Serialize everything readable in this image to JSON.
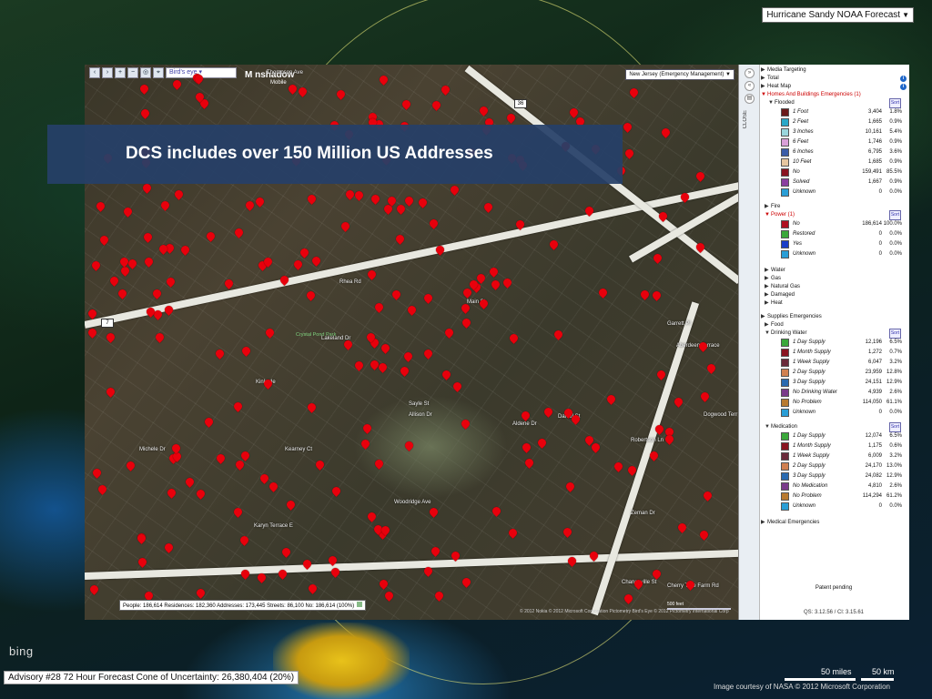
{
  "forecast_dropdown": "Hurricane Sandy NOAA Forecast",
  "bing_logo": "bing",
  "advisory_text": "Advisory #28 72 Hour Forecast Cone of Uncertainty: 26,380,404 (20%)",
  "scale_miles": "50 miles",
  "scale_km": "50 km",
  "image_credit": "Image courtesy of NASA   © 2012 Microsoft Corporation",
  "banner_text": "DCS includes over 150 Million US Addresses",
  "map": {
    "birds_eye": "Bird's eye",
    "logo_main": "M   nshadow",
    "logo_sub": "Mobile",
    "region": "New Jersey (Emergency Management)",
    "park": "Crystal Pond Park",
    "route_7": "7",
    "route_36": "36",
    "status": "People: 186,614  Residences: 182,360  Addresses: 173,445  Streets: 86,100  No: 186,614 (100%)",
    "credit": "© 2012 Nokia   © 2012 Microsoft Corporation   Pictometry Bird's Eye © 2012 Pictometry International Corp",
    "scale": "500 feet",
    "streets": [
      "Thompson Ave",
      "Main St",
      "Garrett Pl",
      "Kinkade",
      "Lakeland Dr",
      "Sayle St",
      "Allison Dr",
      "Woodridge Ave",
      "Karyn Terrace E",
      "Michele Dr",
      "Robertson Ln",
      "Zeman Dr",
      "Chanceville St",
      "Rhea Rd",
      "Daniel St",
      "Aldene Dr",
      "Kearney Ct",
      "Aberdeen Terrace",
      "Dogwood Terr",
      "Cherry Tree Farm Rd"
    ]
  },
  "panel": {
    "close_label": "CLOSE",
    "media_targeting": "Media Targeting",
    "total": "Total",
    "heat_map": "Heat Map",
    "homes_buildings": "Homes And Buildings Emergencies (1)",
    "flooded": "Flooded",
    "flooded_items": [
      {
        "label": "1 Foot",
        "value": "3,404",
        "pct": "1.8%",
        "color": "#6b1a1a"
      },
      {
        "label": "2 Feet",
        "value": "1,665",
        "pct": "0.9%",
        "color": "#2aa8c8"
      },
      {
        "label": "3 Inches",
        "value": "10,161",
        "pct": "5.4%",
        "color": "#9ad6dc"
      },
      {
        "label": "6 Feet",
        "value": "1,746",
        "pct": "0.9%",
        "color": "#d9a0d8"
      },
      {
        "label": "6 Inches",
        "value": "6,795",
        "pct": "3.6%",
        "color": "#3b5da8"
      },
      {
        "label": "10 Feet",
        "value": "1,685",
        "pct": "0.9%",
        "color": "#e6c6a0"
      },
      {
        "label": "No",
        "value": "159,491",
        "pct": "85.5%",
        "color": "#8a1420"
      },
      {
        "label": "Solved",
        "value": "1,667",
        "pct": "0.9%",
        "color": "#8a3fa0"
      },
      {
        "label": "Unknown",
        "value": "0",
        "pct": "0.0%",
        "color": "#2a9ed6"
      }
    ],
    "fire": "Fire",
    "power": "Power (1)",
    "power_items": [
      {
        "label": "No",
        "value": "186,614",
        "pct": "100.0%",
        "color": "#b01020"
      },
      {
        "label": "Restored",
        "value": "0",
        "pct": "0.0%",
        "color": "#3aa83a"
      },
      {
        "label": "Yes",
        "value": "0",
        "pct": "0.0%",
        "color": "#1a3ec8"
      },
      {
        "label": "Unknown",
        "value": "0",
        "pct": "0.0%",
        "color": "#2a9ed6"
      }
    ],
    "water": "Water",
    "gas": "Gas",
    "natural_gas": "Natural Gas",
    "damaged": "Damaged",
    "heat": "Heat",
    "supplies": "Supplies Emergencies",
    "food": "Food",
    "drinking_water": "Drinking Water",
    "water_items": [
      {
        "label": "1 Day Supply",
        "value": "12,196",
        "pct": "6.5%",
        "color": "#3aa83a"
      },
      {
        "label": "1 Month Supply",
        "value": "1,272",
        "pct": "0.7%",
        "color": "#8a1420"
      },
      {
        "label": "1 Week Supply",
        "value": "6,047",
        "pct": "3.2%",
        "color": "#6a2a3a"
      },
      {
        "label": "2 Day Supply",
        "value": "23,959",
        "pct": "12.8%",
        "color": "#d08050"
      },
      {
        "label": "3 Day Supply",
        "value": "24,151",
        "pct": "12.9%",
        "color": "#2a6ab0"
      },
      {
        "label": "No Drinking Water",
        "value": "4,939",
        "pct": "2.6%",
        "color": "#7a3a8a"
      },
      {
        "label": "No Problem",
        "value": "114,050",
        "pct": "61.1%",
        "color": "#b87a30"
      },
      {
        "label": "Unknown",
        "value": "0",
        "pct": "0.0%",
        "color": "#2a9ed6"
      }
    ],
    "medication": "Medication",
    "medication_items": [
      {
        "label": "1 Day Supply",
        "value": "12,074",
        "pct": "6.5%",
        "color": "#3aa83a"
      },
      {
        "label": "1 Month Supply",
        "value": "1,175",
        "pct": "0.6%",
        "color": "#8a1420"
      },
      {
        "label": "1 Week Supply",
        "value": "6,009",
        "pct": "3.2%",
        "color": "#6a2a3a"
      },
      {
        "label": "2 Day Supply",
        "value": "24,170",
        "pct": "13.0%",
        "color": "#d08050"
      },
      {
        "label": "3 Day Supply",
        "value": "24,082",
        "pct": "12.9%",
        "color": "#2a6ab0"
      },
      {
        "label": "No Medication",
        "value": "4,810",
        "pct": "2.6%",
        "color": "#7a3a8a"
      },
      {
        "label": "No Problem",
        "value": "114,294",
        "pct": "61.2%",
        "color": "#b87a30"
      },
      {
        "label": "Unknown",
        "value": "0",
        "pct": "0.0%",
        "color": "#2a9ed6"
      }
    ],
    "medical": "Medical Emergencies",
    "sort_label": "Sort",
    "patent": "Patent pending",
    "qs": "QS: 3.12.56 / Cl: 3.15.61"
  }
}
